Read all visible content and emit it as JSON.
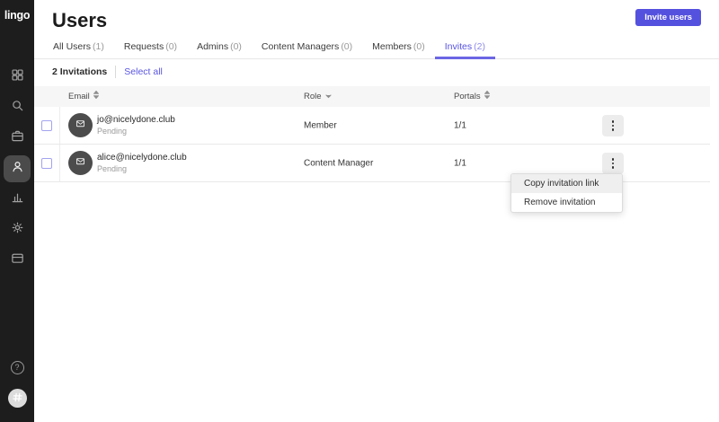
{
  "sidebar": {
    "logo": "lingo",
    "help_label": "?",
    "nav": [
      {
        "name": "dashboard"
      },
      {
        "name": "search"
      },
      {
        "name": "workspace"
      },
      {
        "name": "users",
        "active": true
      },
      {
        "name": "analytics"
      },
      {
        "name": "settings"
      },
      {
        "name": "billing"
      }
    ]
  },
  "header": {
    "title": "Users",
    "invite_button_label": "Invite users"
  },
  "tabs": [
    {
      "label": "All Users",
      "count": "(1)"
    },
    {
      "label": "Requests",
      "count": "(0)"
    },
    {
      "label": "Admins",
      "count": "(0)"
    },
    {
      "label": "Content Managers",
      "count": "(0)"
    },
    {
      "label": "Members",
      "count": "(0)"
    },
    {
      "label": "Invites",
      "count": "(2)",
      "active": true
    }
  ],
  "toolbar": {
    "invitation_count_label": "2 Invitations",
    "select_all_label": "Select all"
  },
  "table": {
    "columns": [
      {
        "label": "Email",
        "sort_icon": "updown"
      },
      {
        "label": "Role",
        "sort_icon": "down"
      },
      {
        "label": "Portals",
        "sort_icon": "updown"
      }
    ],
    "rows": [
      {
        "email": "jo@nicelydone.club",
        "status": "Pending",
        "role": "Member",
        "portals": "1/1"
      },
      {
        "email": "alice@nicelydone.club",
        "status": "Pending",
        "role": "Content Manager",
        "portals": "1/1"
      }
    ]
  },
  "context_menu": {
    "items": [
      {
        "label": "Copy invitation link",
        "highlighted": true
      },
      {
        "label": "Remove invitation",
        "highlighted": false
      }
    ]
  },
  "colors": {
    "accent": "#5551df",
    "active_tab": "#5752e0",
    "sidebar_bg": "#1d1d1d",
    "sidebar_active_bg": "#4b4b4b",
    "table_header_bg": "#f6f6f6",
    "menu_hover_bg": "#efefef",
    "pending_text": "#9a9a9a"
  }
}
